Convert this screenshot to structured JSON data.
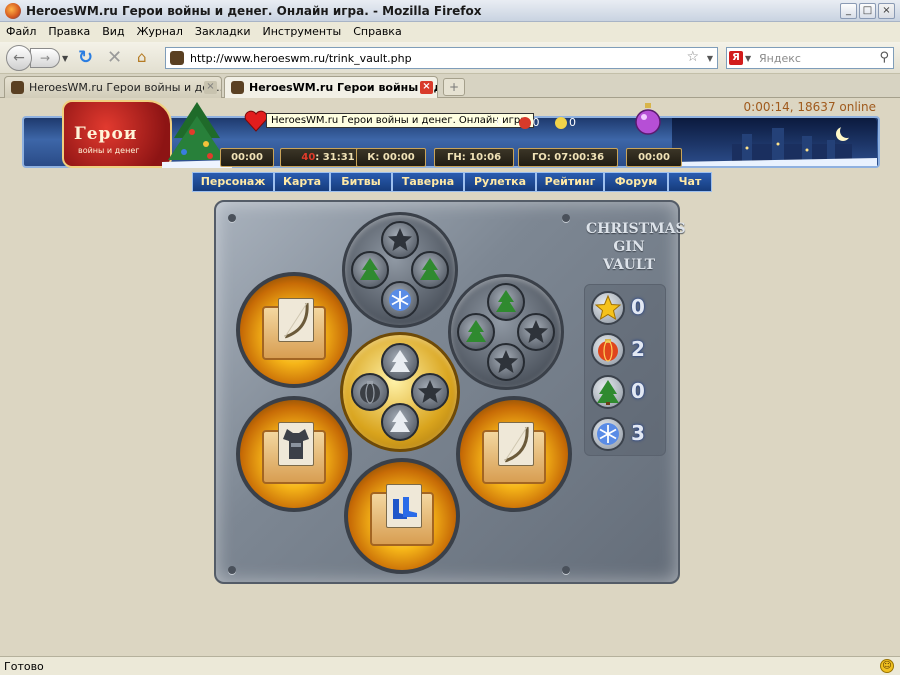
{
  "window": {
    "title": "HeroesWM.ru Герои войны и денег. Онлайн игра. - Mozilla Firefox",
    "controls": {
      "minimize": "_",
      "maximize": "□",
      "close": "×"
    }
  },
  "menubar": [
    "Файл",
    "Правка",
    "Вид",
    "Журнал",
    "Закладки",
    "Инструменты",
    "Справка"
  ],
  "navbar": {
    "url": "http://www.heroeswm.ru/trink_vault.php",
    "search_placeholder": "Яндекс",
    "search_engine_letter": "Я"
  },
  "tabs": [
    {
      "label": "HeroesWM.ru Герои войны и ден...",
      "active": false
    },
    {
      "label": "HeroesWM.ru Герои войны и ден...",
      "active": true
    }
  ],
  "newtab": "+",
  "game": {
    "online_status": "0:00:14, 18637 online",
    "logo_text": "Герои",
    "logo_sub": "войны и денег",
    "tooltip": "HeroesWM.ru Герои войны и денег. Онлайн игра.",
    "resources": [
      "0",
      "0",
      "0"
    ],
    "timers": [
      {
        "label": "00:00"
      },
      {
        "label": "31:31",
        "prefix": "40"
      },
      {
        "label": "К: 00:00"
      },
      {
        "label": "ГН: 10:06"
      },
      {
        "label": "ГО: 07:00:36"
      },
      {
        "label": "00:00"
      }
    ],
    "menu": [
      "Персонаж",
      "Карта",
      "Битвы",
      "Таверна",
      "Рулетка",
      "Рейтинг",
      "Форум",
      "Чат"
    ]
  },
  "vault": {
    "title_line1": "CHRISTMAS",
    "title_line2": "GIN VAULT",
    "counters": [
      {
        "icon": "star-icon",
        "value": "0",
        "color": "#f5c21a"
      },
      {
        "icon": "bauble-icon",
        "value": "2",
        "color": "#e0451b"
      },
      {
        "icon": "tree-icon",
        "value": "0",
        "color": "#2f8a2f"
      },
      {
        "icon": "snowflake-icon",
        "value": "3",
        "color": "#5a8ce6"
      }
    ],
    "chests": [
      {
        "name": "bow-chest-top-left",
        "item_icon": "bow-icon"
      },
      {
        "name": "armor-chest-bottom-left",
        "item_icon": "armor-icon"
      },
      {
        "name": "bow-chest-right",
        "item_icon": "bow-icon"
      },
      {
        "name": "boots-chest-bottom",
        "item_icon": "boots-icon"
      }
    ]
  },
  "statusbar": {
    "text": "Готово"
  }
}
